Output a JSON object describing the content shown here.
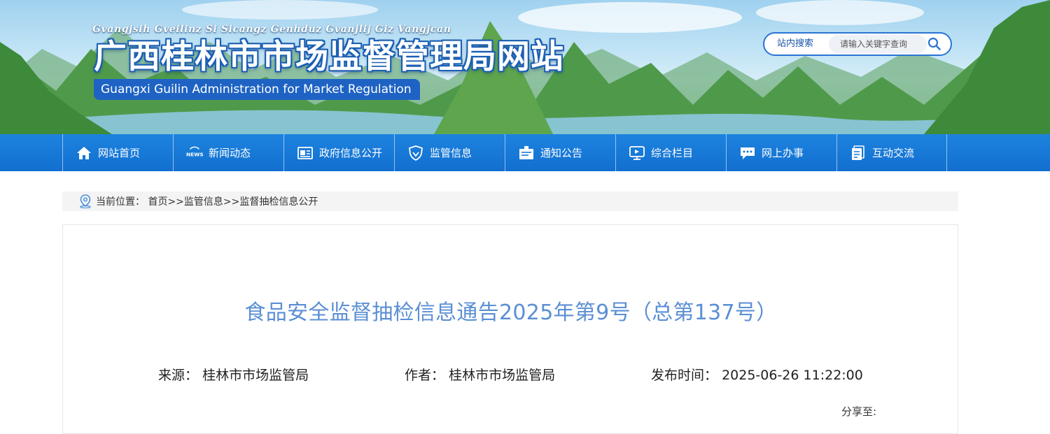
{
  "header": {
    "site_title_latin": "Gvangjsih Gveilinz Si Sicangz Genhduz Gvanjlij Giz Vangjcan",
    "site_title_cn": "广西桂林市市场监督管理局网站",
    "site_title_en": "Guangxi Guilin Administration for Market Regulation"
  },
  "search": {
    "label": "站内搜索",
    "placeholder": "请输入关键字查询",
    "button_icon": "search-icon"
  },
  "nav": {
    "items": [
      {
        "label": "网站首页",
        "icon": "home-icon"
      },
      {
        "label": "新闻动态",
        "icon": "news-icon"
      },
      {
        "label": "政府信息公开",
        "icon": "newspaper-icon"
      },
      {
        "label": "监管信息",
        "icon": "shield-icon"
      },
      {
        "label": "通知公告",
        "icon": "notice-icon"
      },
      {
        "label": "综合栏目",
        "icon": "monitor-icon"
      },
      {
        "label": "网上办事",
        "icon": "chat-icon"
      },
      {
        "label": "互动交流",
        "icon": "document-icon"
      }
    ]
  },
  "breadcrumb": {
    "prefix": "当前位置：",
    "home": "首页",
    "sep": ">>",
    "level1": "监管信息",
    "level2": "监督抽检信息公开"
  },
  "article": {
    "title": "食品安全监督抽检信息通告2025年第9号（总第137号）",
    "source_label": "来源：",
    "source": "桂林市市场监管局",
    "author_label": "作者：",
    "author": "桂林市市场监管局",
    "date_label": "发布时间：",
    "date": "2025-06-26 11:22:00",
    "share_label": "分享至:"
  },
  "colors": {
    "nav_bg": "#1578d6",
    "title_blue": "#5b8fd4",
    "en_badge": "#1e63c4"
  }
}
